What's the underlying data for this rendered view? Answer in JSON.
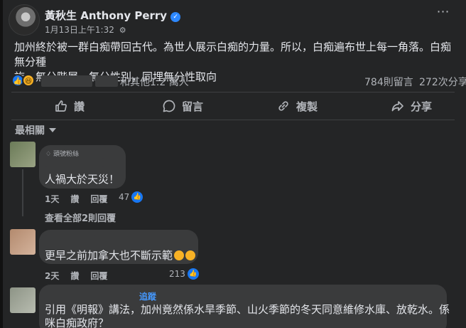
{
  "post": {
    "author": "黃秋生 Anthony Perry",
    "timestamp": "1月13日上午1:32",
    "text_line1": "加州終於被一群白痴帶回古代。為世人展示白痴的力量。所以，白痴遍布世上每一角落。白痴無分種",
    "text_line2": "族，無分階層，無分性別，同埋無分性取向"
  },
  "reactions": {
    "others": "和其他1.2 萬人",
    "comments": "784則留言",
    "shares": "272次分享"
  },
  "actions": {
    "like": "讚",
    "comment": "留言",
    "copy": "複製",
    "share": "分享"
  },
  "sort_label": "最相關",
  "comments": [
    {
      "badge": "頭號粉絲",
      "text": "人禍大於天災！",
      "time": "1天",
      "like": "讚",
      "reply": "回覆",
      "likes": "47"
    },
    {
      "text": "更早之前加拿大也不斷示範",
      "time": "2天",
      "like": "讚",
      "reply": "回覆",
      "likes": "213"
    },
    {
      "follow": "追蹤",
      "text_line1": "引用《明報》講法，加州竟然係水旱季節、山火季節的冬天同意維修水庫、放乾水。係",
      "text_line2": "咪白痴政府？"
    }
  ],
  "view_replies": "查看全部2則回覆",
  "colors": {
    "background": "#242526",
    "bubble": "#3a3b3c",
    "accent": "#1877f2",
    "text": "#e4e6eb",
    "secondary": "#b0b3b8"
  }
}
